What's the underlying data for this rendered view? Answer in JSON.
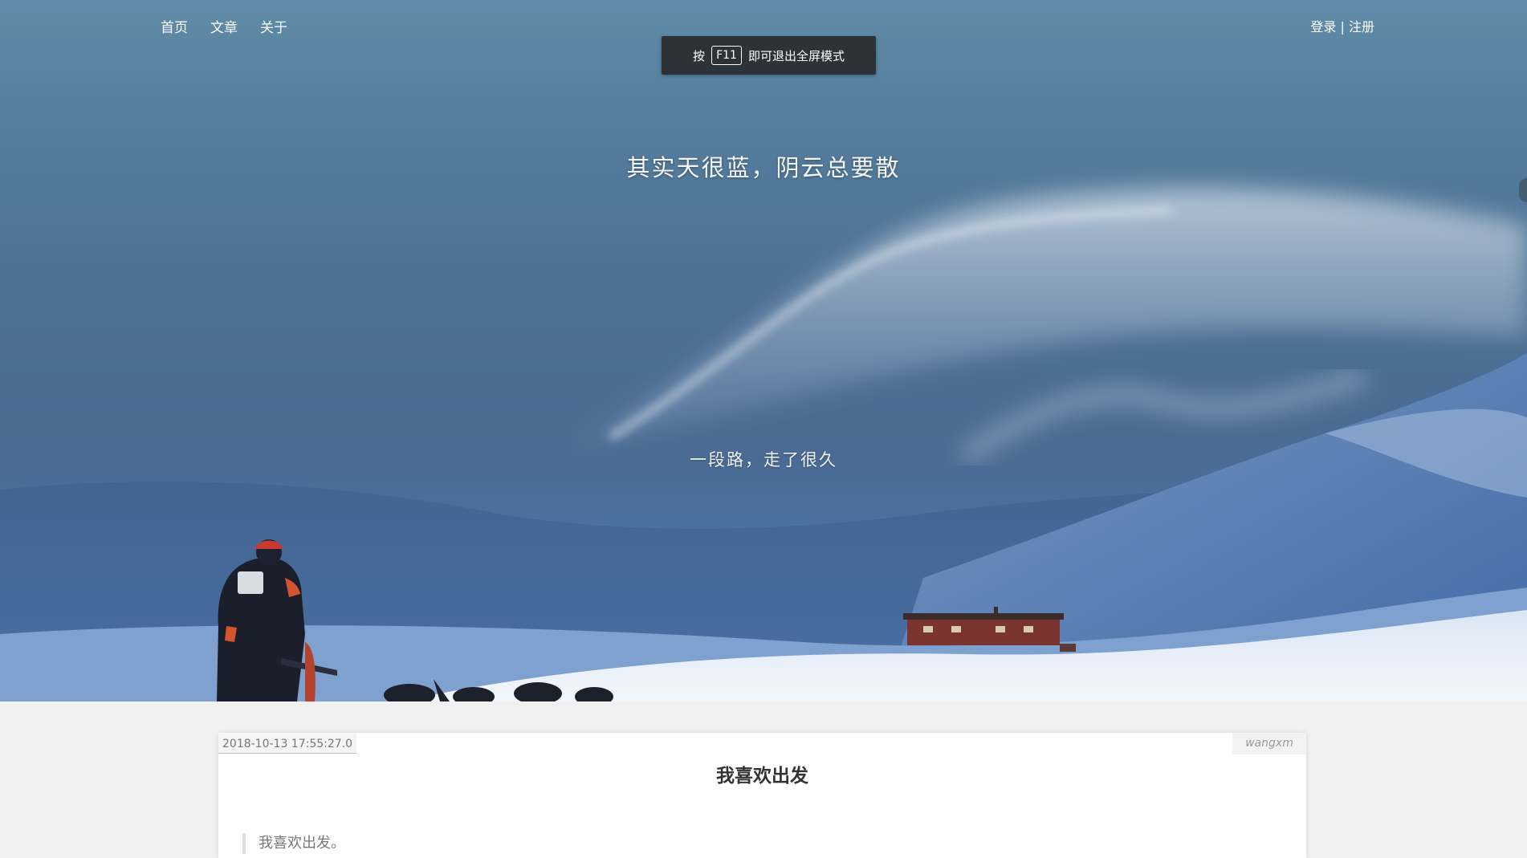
{
  "nav": {
    "items": [
      "首页",
      "文章",
      "关于"
    ]
  },
  "auth": {
    "login": "登录",
    "separator": " | ",
    "register": "注册"
  },
  "fullscreen_notice": {
    "prefix": "按",
    "key": "F11",
    "suffix": "即可退出全屏模式"
  },
  "hero": {
    "title": "其实天很蓝，阴云总要散",
    "subtitle": "一段路，走了很久"
  },
  "post": {
    "date": "2018-10-13 17:55:27.0",
    "author": "wangxm",
    "title": "我喜欢出发",
    "excerpt": "我喜欢出发。"
  },
  "colors": {
    "sky": "#5f8ca8",
    "snow": "#eef3fa",
    "toast_bg": "#2d3237",
    "card_bg": "#ffffff",
    "page_bg": "#f1f1f1"
  }
}
